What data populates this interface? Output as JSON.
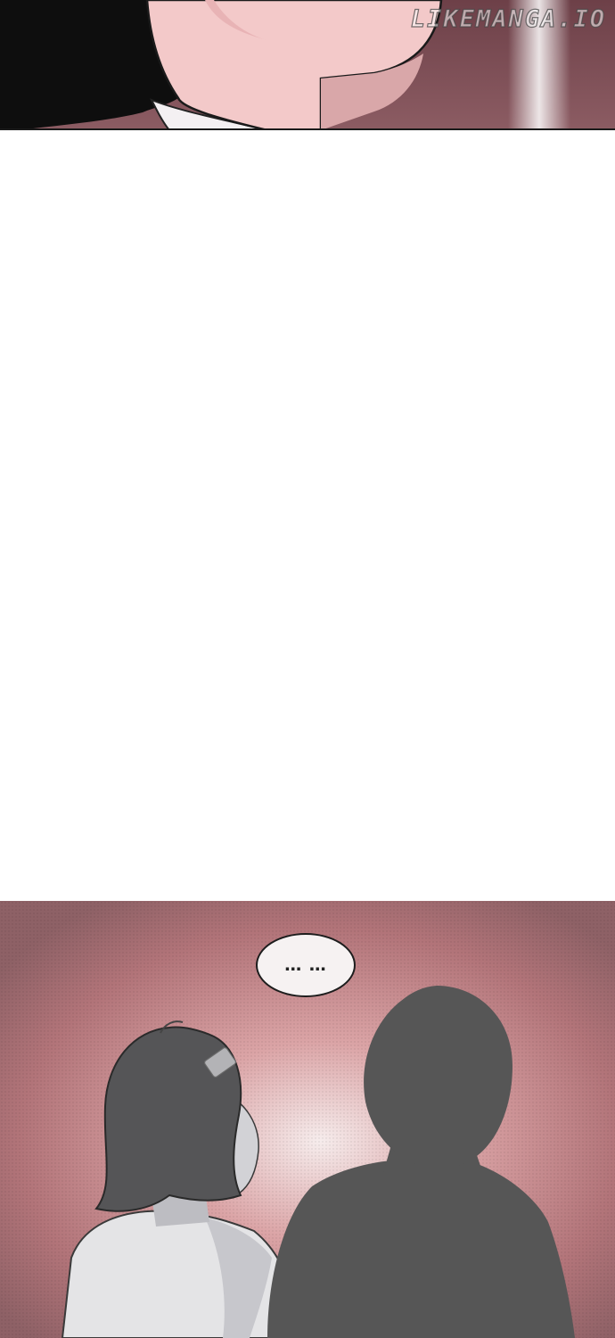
{
  "watermark": {
    "text": "LIKEMANGA.IO"
  },
  "panels": {
    "bottom": {
      "speech_bubble": "… …"
    }
  },
  "colors": {
    "top_panel_bg": "#7a4a52",
    "bottom_panel_bg": "#b47a80",
    "silhouette": "#565656",
    "skin": "#f3c9c9",
    "hair": "#0e0e0e",
    "gutter": "#ffffff"
  }
}
